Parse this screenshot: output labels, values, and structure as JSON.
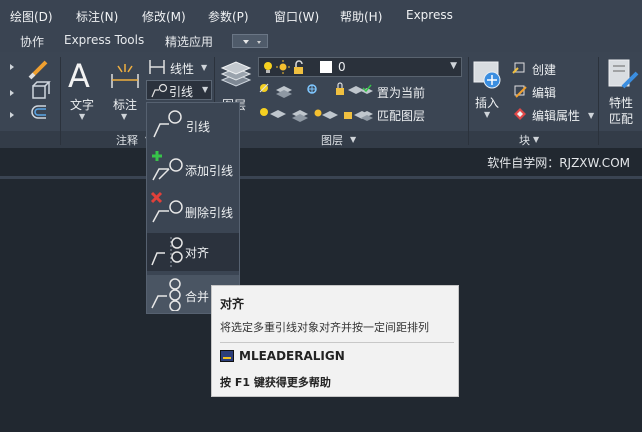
{
  "menubar": {
    "items": [
      "绘图(D)",
      "标注(N)",
      "修改(M)",
      "参数(P)",
      "窗口(W)",
      "帮助(H)",
      "Express"
    ]
  },
  "tabbar": {
    "tabs": [
      "协作",
      "Express Tools",
      "精选应用"
    ]
  },
  "ribbon": {
    "annotation": {
      "text_label": "文字",
      "dim_label": "标注",
      "linear_label": "线性",
      "leader_label": "引线",
      "group_label": "注释"
    },
    "layers": {
      "layer_value": "0",
      "layer_props_label": "图层",
      "set_current_label": "置为当前",
      "match_layer_label": "匹配图层",
      "group_label": "图层"
    },
    "block": {
      "insert_label": "插入",
      "create_label": "创建",
      "edit_label": "编辑",
      "edit_attr_label": "编辑属性",
      "group_label": "块"
    },
    "properties": {
      "label": "特性",
      "match_label": "匹配"
    }
  },
  "brand": "软件自学网：RJZXW.COM",
  "flyout": {
    "items": [
      "引线",
      "添加引线",
      "删除引线",
      "对齐",
      "合并"
    ]
  },
  "tooltip": {
    "title": "对齐",
    "description": "将选定多重引线对象对齐并按一定间距排列",
    "command": "MLEADERALIGN",
    "help": "按 F1 键获得更多帮助"
  },
  "colors": {
    "menubar_bg": "#3a4452",
    "canvas_bg": "#212830",
    "add_accent": "#37c24a",
    "remove_accent": "#e0403a"
  }
}
